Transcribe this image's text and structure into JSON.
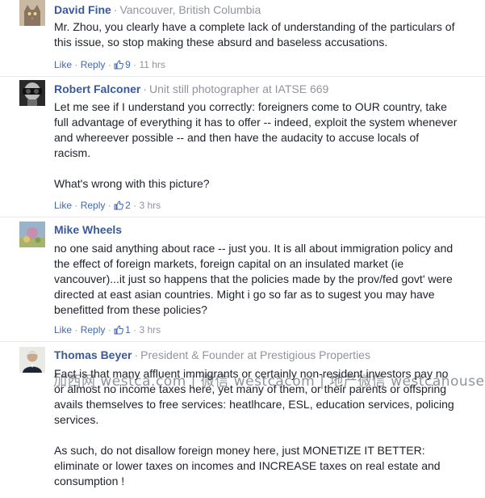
{
  "comments": [
    {
      "author": "David Fine",
      "subtitle": "Vancouver, British Columbia",
      "text": [
        "Mr. Zhou, you clearly have a complete lack of understanding of the particulars of this issue, so stop making these absurd and baseless accusations."
      ],
      "like_label": "Like",
      "reply_label": "Reply",
      "likes": "9",
      "time": "11 hrs"
    },
    {
      "author": "Robert Falconer",
      "subtitle": "Unit still photographer at IATSE 669",
      "text": [
        "Let me see if I understand you correctly: foreigners come to OUR country, take full advantage of everything it has to offer -- indeed, exploit the system whenever and whereever possible -- and then have the audacity to accuse locals of racism.",
        "What's wrong with this picture?"
      ],
      "like_label": "Like",
      "reply_label": "Reply",
      "likes": "2",
      "time": "3 hrs"
    },
    {
      "author": "Mike Wheels",
      "subtitle": "",
      "text": [
        "no one said anything about race -- just you. It is all about immigration policy and the effect of foreign markets, foreign capital on an insulated market (ie vancouver)...it just so happens that the policies made by the prov/fed govt' were directed at east asian countries. Might i go so far as to sugest you may have benefitted from these policies?"
      ],
      "like_label": "Like",
      "reply_label": "Reply",
      "likes": "1",
      "time": "3 hrs"
    },
    {
      "author": "Thomas Beyer",
      "subtitle": "President & Founder at Prestigious Properties",
      "text": [
        "Fact is that many affluent immigrants or certainly non-resident investors pay no or almost no income taxes here, yet many of them, or their parents or offspring avails themselves to free services: heatlhcare, ESL, education services, policing services.",
        "As such, do not disallow foreign money here, just MONETIZE IT BETTER: eliminate or lower taxes on incomes and INCREASE taxes on real estate and consumption !"
      ]
    }
  ],
  "watermark": "加西网 westca.com | 微信 westcacom | 地产微信 westcahouse",
  "colors": {
    "author": "#3b5998",
    "link": "#4267b2",
    "meta": "#90949c",
    "text": "#1d2129"
  }
}
